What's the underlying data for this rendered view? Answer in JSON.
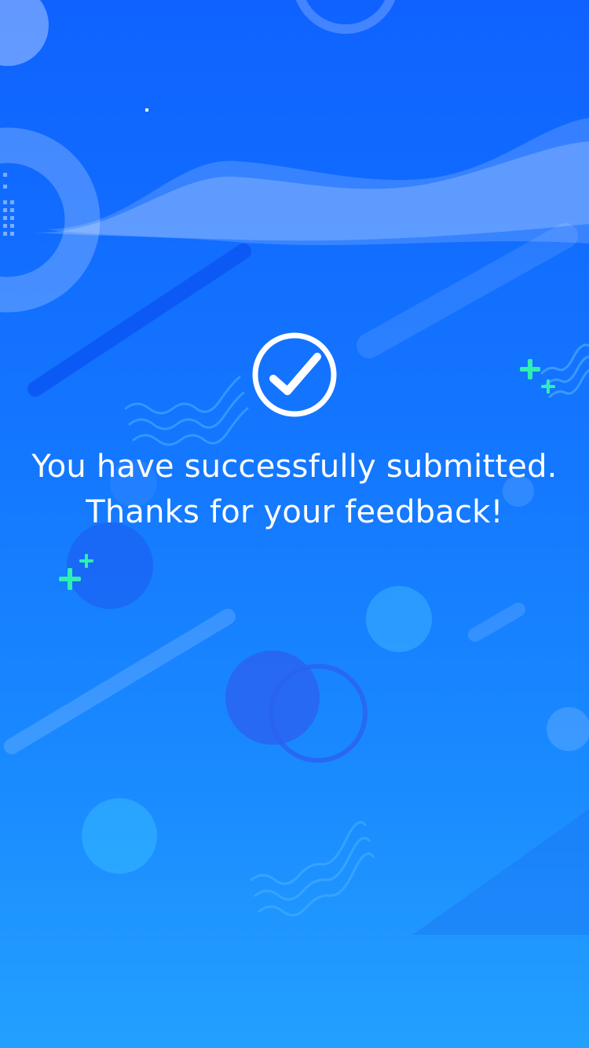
{
  "success_page": {
    "icon": "check-circle-icon",
    "message_line_1": "You have successfully submitted.",
    "message_line_2": "Thanks for your feedback!"
  },
  "colors": {
    "background_top": "#0f62ff",
    "background_bottom": "#23a0ff",
    "text": "#ffffff",
    "sparkle_accent": "#2ef0b0"
  }
}
